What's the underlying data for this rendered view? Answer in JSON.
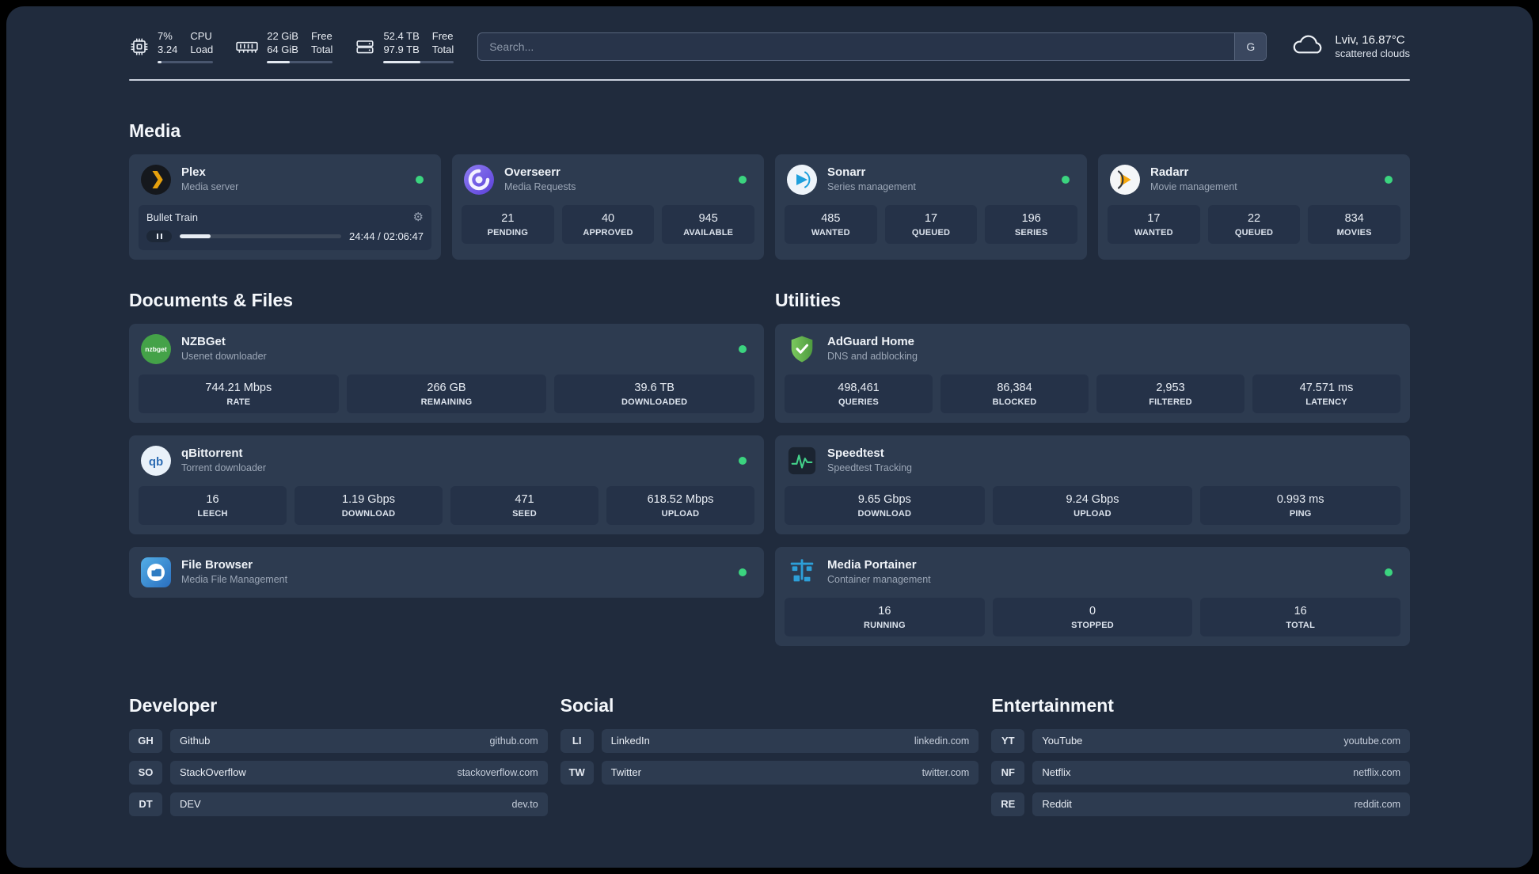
{
  "topbar": {
    "cpu": {
      "value1": "7%",
      "value2": "3.24",
      "label1": "CPU",
      "label2": "Load",
      "progress": 7
    },
    "ram": {
      "value1": "22 GiB",
      "value2": "64 GiB",
      "label1": "Free",
      "label2": "Total",
      "progress": 34
    },
    "disk": {
      "value1": "52.4 TB",
      "value2": "97.9 TB",
      "label1": "Free",
      "label2": "Total",
      "progress": 53
    },
    "search": {
      "placeholder": "Search...",
      "button_label": "G"
    },
    "weather": {
      "location": "Lviv, 16.87°C",
      "condition": "scattered clouds"
    }
  },
  "media": {
    "heading": "Media",
    "plex": {
      "name": "Plex",
      "subtitle": "Media server",
      "now_playing": "Bullet Train",
      "time": "24:44 / 02:06:47",
      "progress": 19
    },
    "overseerr": {
      "name": "Overseerr",
      "subtitle": "Media Requests",
      "stats": [
        {
          "value": "21",
          "label": "PENDING"
        },
        {
          "value": "40",
          "label": "APPROVED"
        },
        {
          "value": "945",
          "label": "AVAILABLE"
        }
      ]
    },
    "sonarr": {
      "name": "Sonarr",
      "subtitle": "Series management",
      "stats": [
        {
          "value": "485",
          "label": "WANTED"
        },
        {
          "value": "17",
          "label": "QUEUED"
        },
        {
          "value": "196",
          "label": "SERIES"
        }
      ]
    },
    "radarr": {
      "name": "Radarr",
      "subtitle": "Movie management",
      "stats": [
        {
          "value": "17",
          "label": "WANTED"
        },
        {
          "value": "22",
          "label": "QUEUED"
        },
        {
          "value": "834",
          "label": "MOVIES"
        }
      ]
    }
  },
  "documents": {
    "heading": "Documents & Files",
    "nzbget": {
      "name": "NZBGet",
      "subtitle": "Usenet downloader",
      "stats": [
        {
          "value": "744.21 Mbps",
          "label": "RATE"
        },
        {
          "value": "266 GB",
          "label": "REMAINING"
        },
        {
          "value": "39.6 TB",
          "label": "DOWNLOADED"
        }
      ]
    },
    "qbittorrent": {
      "name": "qBittorrent",
      "subtitle": "Torrent downloader",
      "stats": [
        {
          "value": "16",
          "label": "LEECH"
        },
        {
          "value": "1.19 Gbps",
          "label": "DOWNLOAD"
        },
        {
          "value": "471",
          "label": "SEED"
        },
        {
          "value": "618.52 Mbps",
          "label": "UPLOAD"
        }
      ]
    },
    "filebrowser": {
      "name": "File Browser",
      "subtitle": "Media File Management"
    }
  },
  "utilities": {
    "heading": "Utilities",
    "adguard": {
      "name": "AdGuard Home",
      "subtitle": "DNS and adblocking",
      "stats": [
        {
          "value": "498,461",
          "label": "QUERIES"
        },
        {
          "value": "86,384",
          "label": "BLOCKED"
        },
        {
          "value": "2,953",
          "label": "FILTERED"
        },
        {
          "value": "47.571 ms",
          "label": "LATENCY"
        }
      ]
    },
    "speedtest": {
      "name": "Speedtest",
      "subtitle": "Speedtest Tracking",
      "stats": [
        {
          "value": "9.65 Gbps",
          "label": "DOWNLOAD"
        },
        {
          "value": "9.24 Gbps",
          "label": "UPLOAD"
        },
        {
          "value": "0.993 ms",
          "label": "PING"
        }
      ]
    },
    "portainer": {
      "name": "Media Portainer",
      "subtitle": "Container management",
      "stats": [
        {
          "value": "16",
          "label": "RUNNING"
        },
        {
          "value": "0",
          "label": "STOPPED"
        },
        {
          "value": "16",
          "label": "TOTAL"
        }
      ]
    }
  },
  "bookmarks": {
    "developer": {
      "heading": "Developer",
      "items": [
        {
          "abbr": "GH",
          "name": "Github",
          "url": "github.com"
        },
        {
          "abbr": "SO",
          "name": "StackOverflow",
          "url": "stackoverflow.com"
        },
        {
          "abbr": "DT",
          "name": "DEV",
          "url": "dev.to"
        }
      ]
    },
    "social": {
      "heading": "Social",
      "items": [
        {
          "abbr": "LI",
          "name": "LinkedIn",
          "url": "linkedin.com"
        },
        {
          "abbr": "TW",
          "name": "Twitter",
          "url": "twitter.com"
        }
      ]
    },
    "entertainment": {
      "heading": "Entertainment",
      "items": [
        {
          "abbr": "YT",
          "name": "YouTube",
          "url": "youtube.com"
        },
        {
          "abbr": "NF",
          "name": "Netflix",
          "url": "netflix.com"
        },
        {
          "abbr": "RE",
          "name": "Reddit",
          "url": "reddit.com"
        }
      ]
    }
  },
  "colors": {
    "status_online": "#3bd47f",
    "accent_plex": "#e5a00d",
    "accent_overseerr": "#6c5ce7",
    "accent_green": "#4caf50"
  }
}
